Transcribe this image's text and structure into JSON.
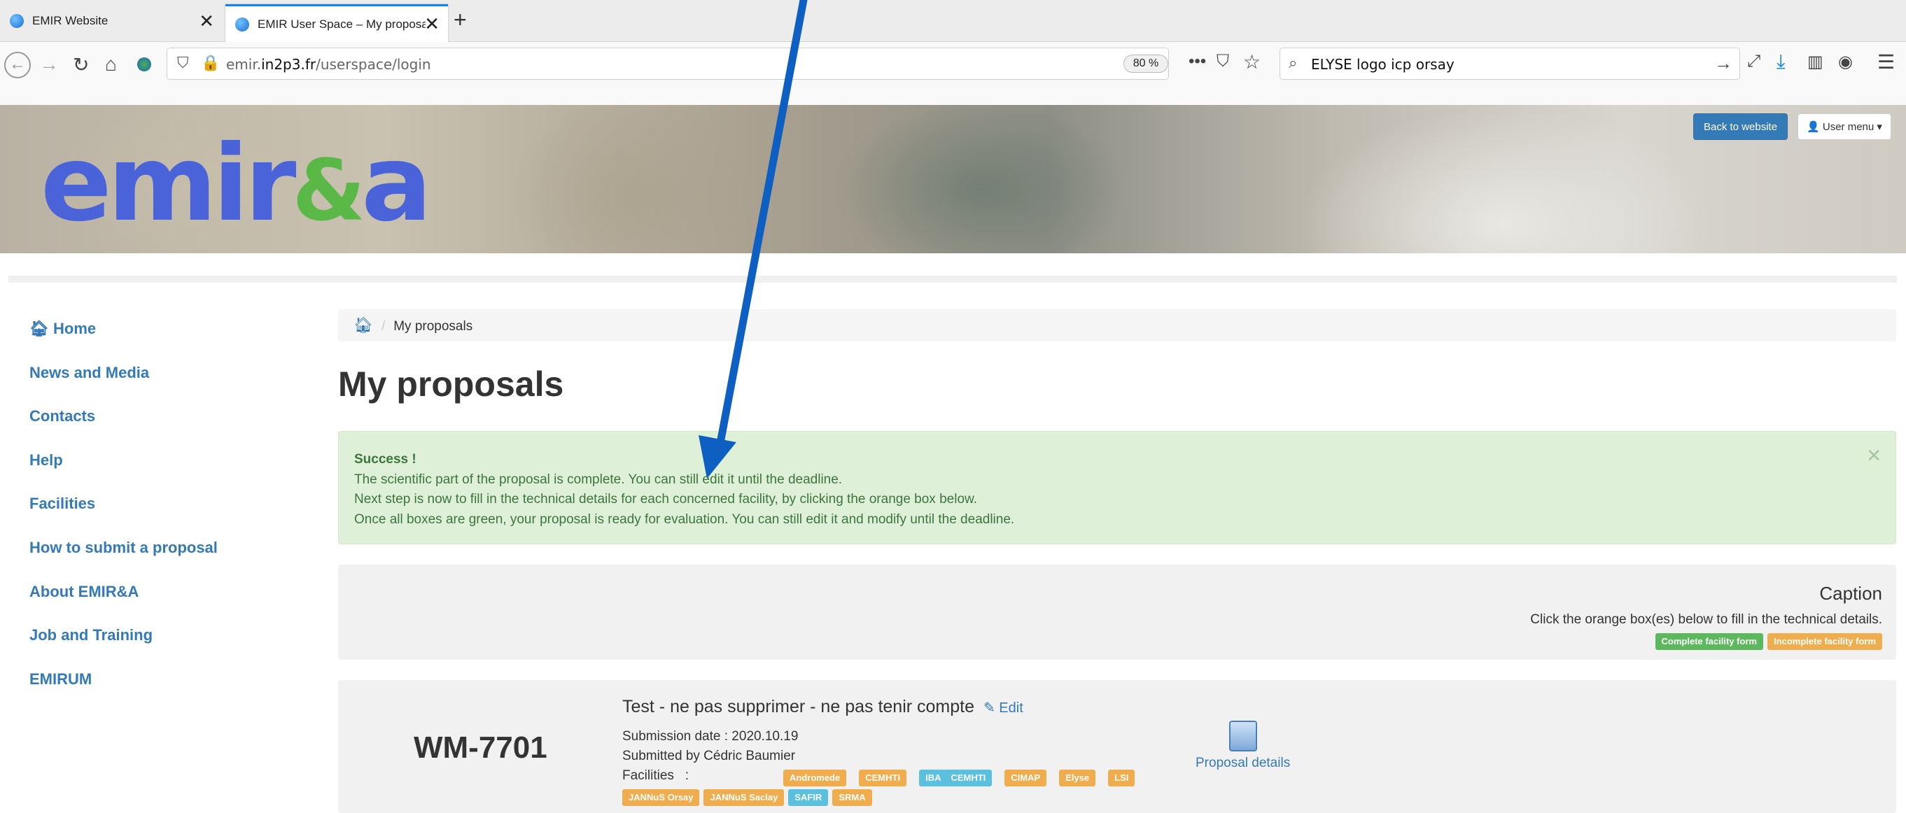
{
  "browser": {
    "tabs": [
      {
        "title": "EMIR Website"
      },
      {
        "title": "EMIR User Space – My proposal"
      }
    ],
    "url_prefix": "emir.",
    "url_host": "in2p3.fr",
    "url_path": "/userspace/login",
    "zoom": "80 %",
    "search_query": "ELYSE logo icp orsay"
  },
  "header": {
    "logo_text_1": "em",
    "logo_text_2": "ir",
    "logo_text_3": "&",
    "logo_text_4": "a",
    "back_button": "Back to website",
    "user_menu": "User menu"
  },
  "sidebar": {
    "items": [
      {
        "label": "Home"
      },
      {
        "label": "News and Media"
      },
      {
        "label": "Contacts"
      },
      {
        "label": "Help"
      },
      {
        "label": "Facilities"
      },
      {
        "label": "How to submit a proposal"
      },
      {
        "label": "About EMIR&A"
      },
      {
        "label": "Job and Training"
      },
      {
        "label": "EMIRUM"
      }
    ]
  },
  "main": {
    "breadcrumb_current": "My proposals",
    "title": "My proposals",
    "alert": {
      "heading": "Success !",
      "line1": "The scientific part of the proposal is complete. You can still edit it until the deadline.",
      "line2": "Next step is now to fill in the technical details for each concerned facility, by clicking the orange box below.",
      "line3": "Once all boxes are green, your proposal is ready for evaluation. You can still edit it and modify until the deadline."
    },
    "caption": {
      "title": "Caption",
      "text": "Click the orange box(es) below to fill in the technical details.",
      "complete": "Complete facility form",
      "incomplete": "Incomplete facility form"
    },
    "proposal": {
      "id": "WM-7701",
      "title": "Test - ne pas supprimer - ne pas tenir compte",
      "edit": "Edit",
      "submission": "Submission date : 2020.10.19",
      "submitted_by": "Submitted by Cédric Baumier",
      "facilities_label": "Facilities   :",
      "facilities_row1": [
        {
          "name": "Andromede",
          "status": "orange"
        },
        {
          "name": "CEMHTI",
          "status": "orange"
        },
        {
          "name": "IBA    CEMHTI",
          "status": "blue"
        },
        {
          "name": "CIMAP",
          "status": "orange"
        },
        {
          "name": "Elyse",
          "status": "orange"
        },
        {
          "name": "LSI",
          "status": "orange"
        }
      ],
      "facilities_row2": [
        {
          "name": "JANNuS Orsay",
          "status": "orange"
        },
        {
          "name": "JANNuS Saclay",
          "status": "orange"
        },
        {
          "name": "SAFIR",
          "status": "blue"
        },
        {
          "name": "SRMA",
          "status": "orange"
        }
      ],
      "details_link": "Proposal details"
    }
  },
  "colors": {
    "link_blue": "#337ab7",
    "success_bg": "#dff0d8",
    "label_green": "#5cb85c",
    "label_orange": "#f0ad4e",
    "label_blue": "#5bc0de",
    "annotation_arrow": "#0d5fc2"
  }
}
